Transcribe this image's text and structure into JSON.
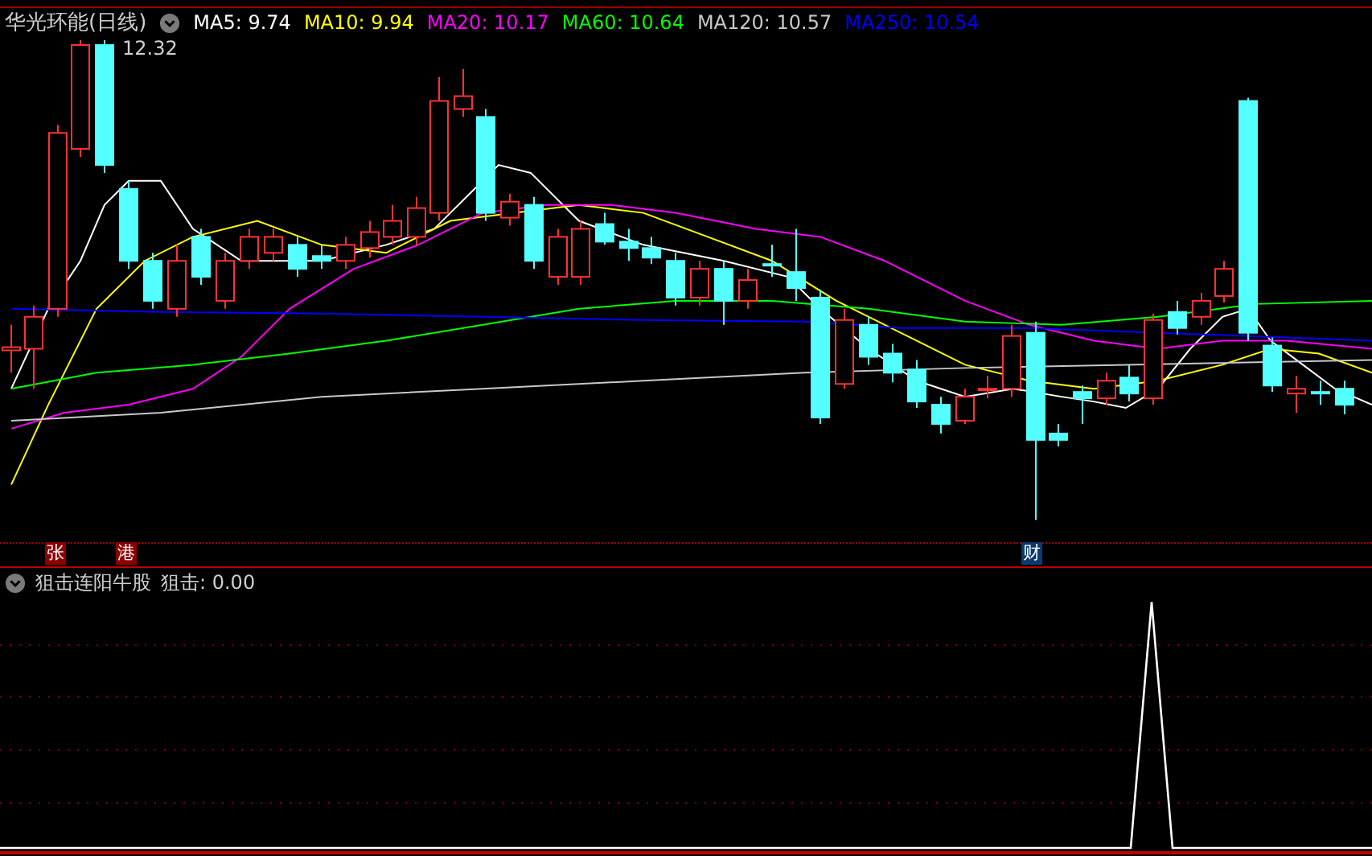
{
  "main_chart": {
    "title": "华光环能(日线)",
    "legend": [
      {
        "label": "MA5: 9.74",
        "color": "#ffffff"
      },
      {
        "label": "MA10: 9.94",
        "color": "#ffff00"
      },
      {
        "label": "MA20: 10.17",
        "color": "#ff00ff"
      },
      {
        "label": "MA60: 10.64",
        "color": "#00ff00"
      },
      {
        "label": "MA120: 10.57",
        "color": "#c8c8c8"
      },
      {
        "label": "MA250: 10.54",
        "color": "#0000ff"
      }
    ],
    "max_price_label": "12.32"
  },
  "event_badges": [
    {
      "text": "张",
      "color": "#8b0000"
    },
    {
      "text": "港",
      "color": "#8b0000"
    },
    {
      "text": "财",
      "color": "#0a3a6e"
    }
  ],
  "indicator": {
    "title": "狙击连阳牛股",
    "reading": "狙击: 0.00"
  }
}
